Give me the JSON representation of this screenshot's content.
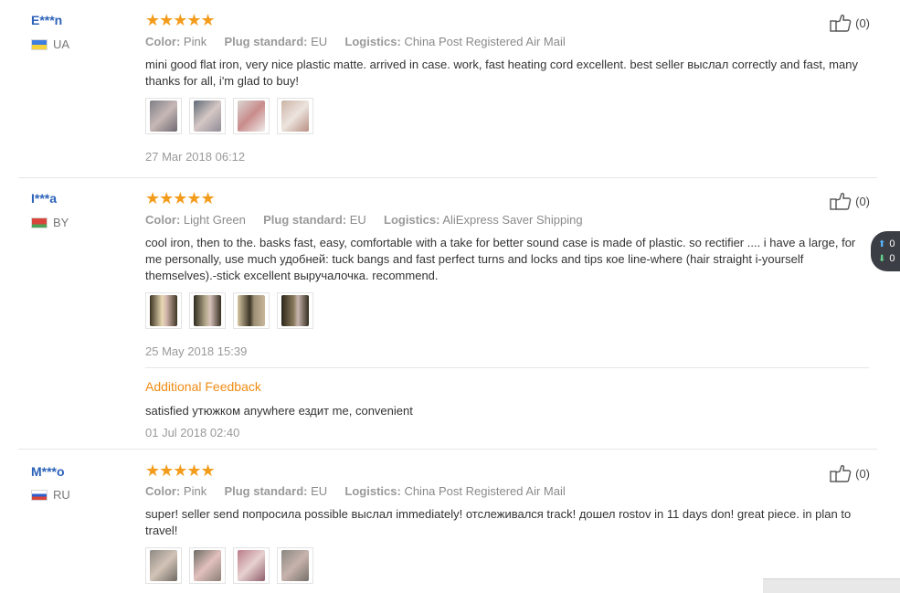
{
  "labels": {
    "color": "Color:",
    "plug": "Plug standard:",
    "logistics": "Logistics:",
    "additional_feedback": "Additional Feedback"
  },
  "reviews": [
    {
      "user": "E***n",
      "country": "UA",
      "stars": "★★★★★",
      "color": "Pink",
      "plug": "EU",
      "logistics": "China Post Registered Air Mail",
      "text": "mini good flat iron, very nice plastic matte. arrived in case. work, fast heating cord excellent. best seller выслал correctly and fast, many thanks for all, i'm glad to buy!",
      "date": "27 Mar 2018 06:12",
      "helpful": "(0)"
    },
    {
      "user": "I***a",
      "country": "BY",
      "stars": "★★★★★",
      "color": "Light Green",
      "plug": "EU",
      "logistics": "AliExpress Saver Shipping",
      "text": "cool iron, then to the. basks fast, easy, comfortable with a take for better sound case is made of plastic. so rectifier .... i have a large, for me personally, use much удобней: tuck bangs and fast perfect turns and locks and tips кое line-where (hair straight i-yourself themselves).-stick excellent выручалочка. recommend.",
      "date": "25 May 2018 15:39",
      "helpful": "(0)",
      "additional_text": "satisfied утюжком anywhere ездит me, convenient",
      "additional_date": "01 Jul 2018 02:40"
    },
    {
      "user": "M***o",
      "country": "RU",
      "stars": "★★★★★",
      "color": "Pink",
      "plug": "EU",
      "logistics": "China Post Registered Air Mail",
      "text": "super! seller send попросила possible выслал immediately! отслеживался track! дошел rostov in 11 days don! great piece. in plan to travel!",
      "helpful": "(0)"
    }
  ],
  "vote_widget": {
    "up": "0",
    "down": "0"
  },
  "icons": {
    "helpful": "thumbs-up-icon",
    "up": "arrow-up-icon",
    "down": "arrow-down-icon"
  }
}
